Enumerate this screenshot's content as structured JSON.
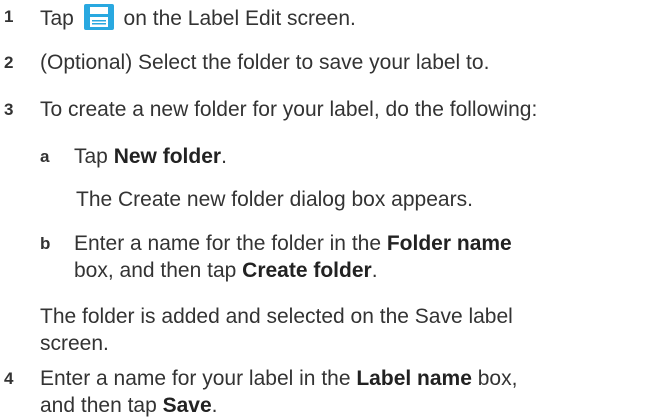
{
  "steps": [
    {
      "number": "1",
      "text_before_icon": "Tap",
      "icon": "save-icon",
      "icon_color": "#29a8e0",
      "text_after_icon": "on the Label Edit screen."
    },
    {
      "number": "2",
      "text": "(Optional) Select the folder to save your label to."
    },
    {
      "number": "3",
      "text": "To create a new folder for your label, do the following:",
      "substeps": [
        {
          "letter": "a",
          "pre": "Tap",
          "bold": "New folder",
          "post": ".",
          "result": "The Create new folder dialog box appears."
        },
        {
          "letter": "b",
          "line1_pre": "Enter a name for the folder in the",
          "line1_bold": "Folder name",
          "line2_pre": "box, and then tap",
          "line2_bold": "Create folder",
          "line2_post": "."
        }
      ],
      "note_line1": "The folder is added and selected on the Save label",
      "note_line2": "screen."
    },
    {
      "number": "4",
      "line1_pre": "Enter a name for your label in the",
      "line1_bold": "Label name",
      "line1_post": "box,",
      "line2_pre": "and then tap",
      "line2_bold": "Save",
      "line2_post": "."
    }
  ]
}
